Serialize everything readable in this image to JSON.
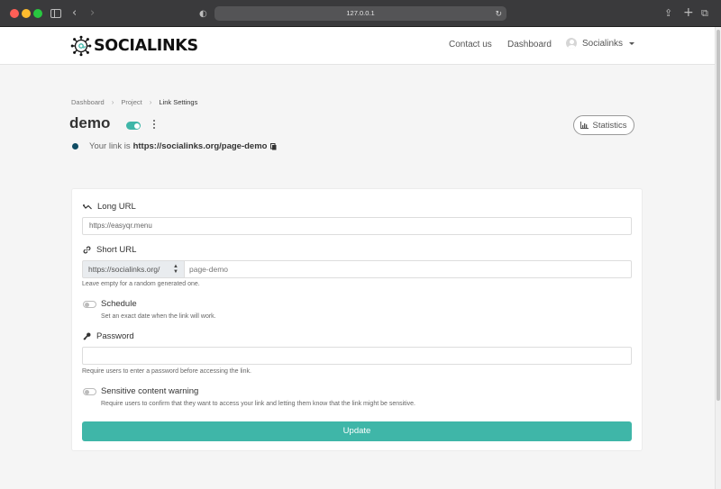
{
  "browser": {
    "url": "127.0.0.1"
  },
  "brand": {
    "name": "SOCIALINKS",
    "accent": "#3fb6a8"
  },
  "nav": {
    "contact": "Contact us",
    "dashboard": "Dashboard",
    "user": "Socialinks"
  },
  "breadcrumb": [
    "Dashboard",
    "Project",
    "Link Settings"
  ],
  "page": {
    "title": "demo",
    "statistics_label": "Statistics",
    "link_prefix": "Your link is",
    "link_url": "https://socialinks.org/page-demo"
  },
  "form": {
    "long_url": {
      "label": "Long URL",
      "value": "https://easyqr.menu"
    },
    "short_url": {
      "label": "Short URL",
      "domain": "https://socialinks.org/",
      "slug_placeholder": "page-demo",
      "help": "Leave empty for a random generated one."
    },
    "schedule": {
      "label": "Schedule",
      "help": "Set an exact date when the link will work."
    },
    "password": {
      "label": "Password",
      "value": "",
      "help": "Require users to enter a password before accessing the link."
    },
    "sensitive": {
      "label": "Sensitive content warning",
      "help": "Require users to confirm that they want to access your link and letting them know that the link might be sensitive."
    },
    "submit": "Update"
  }
}
